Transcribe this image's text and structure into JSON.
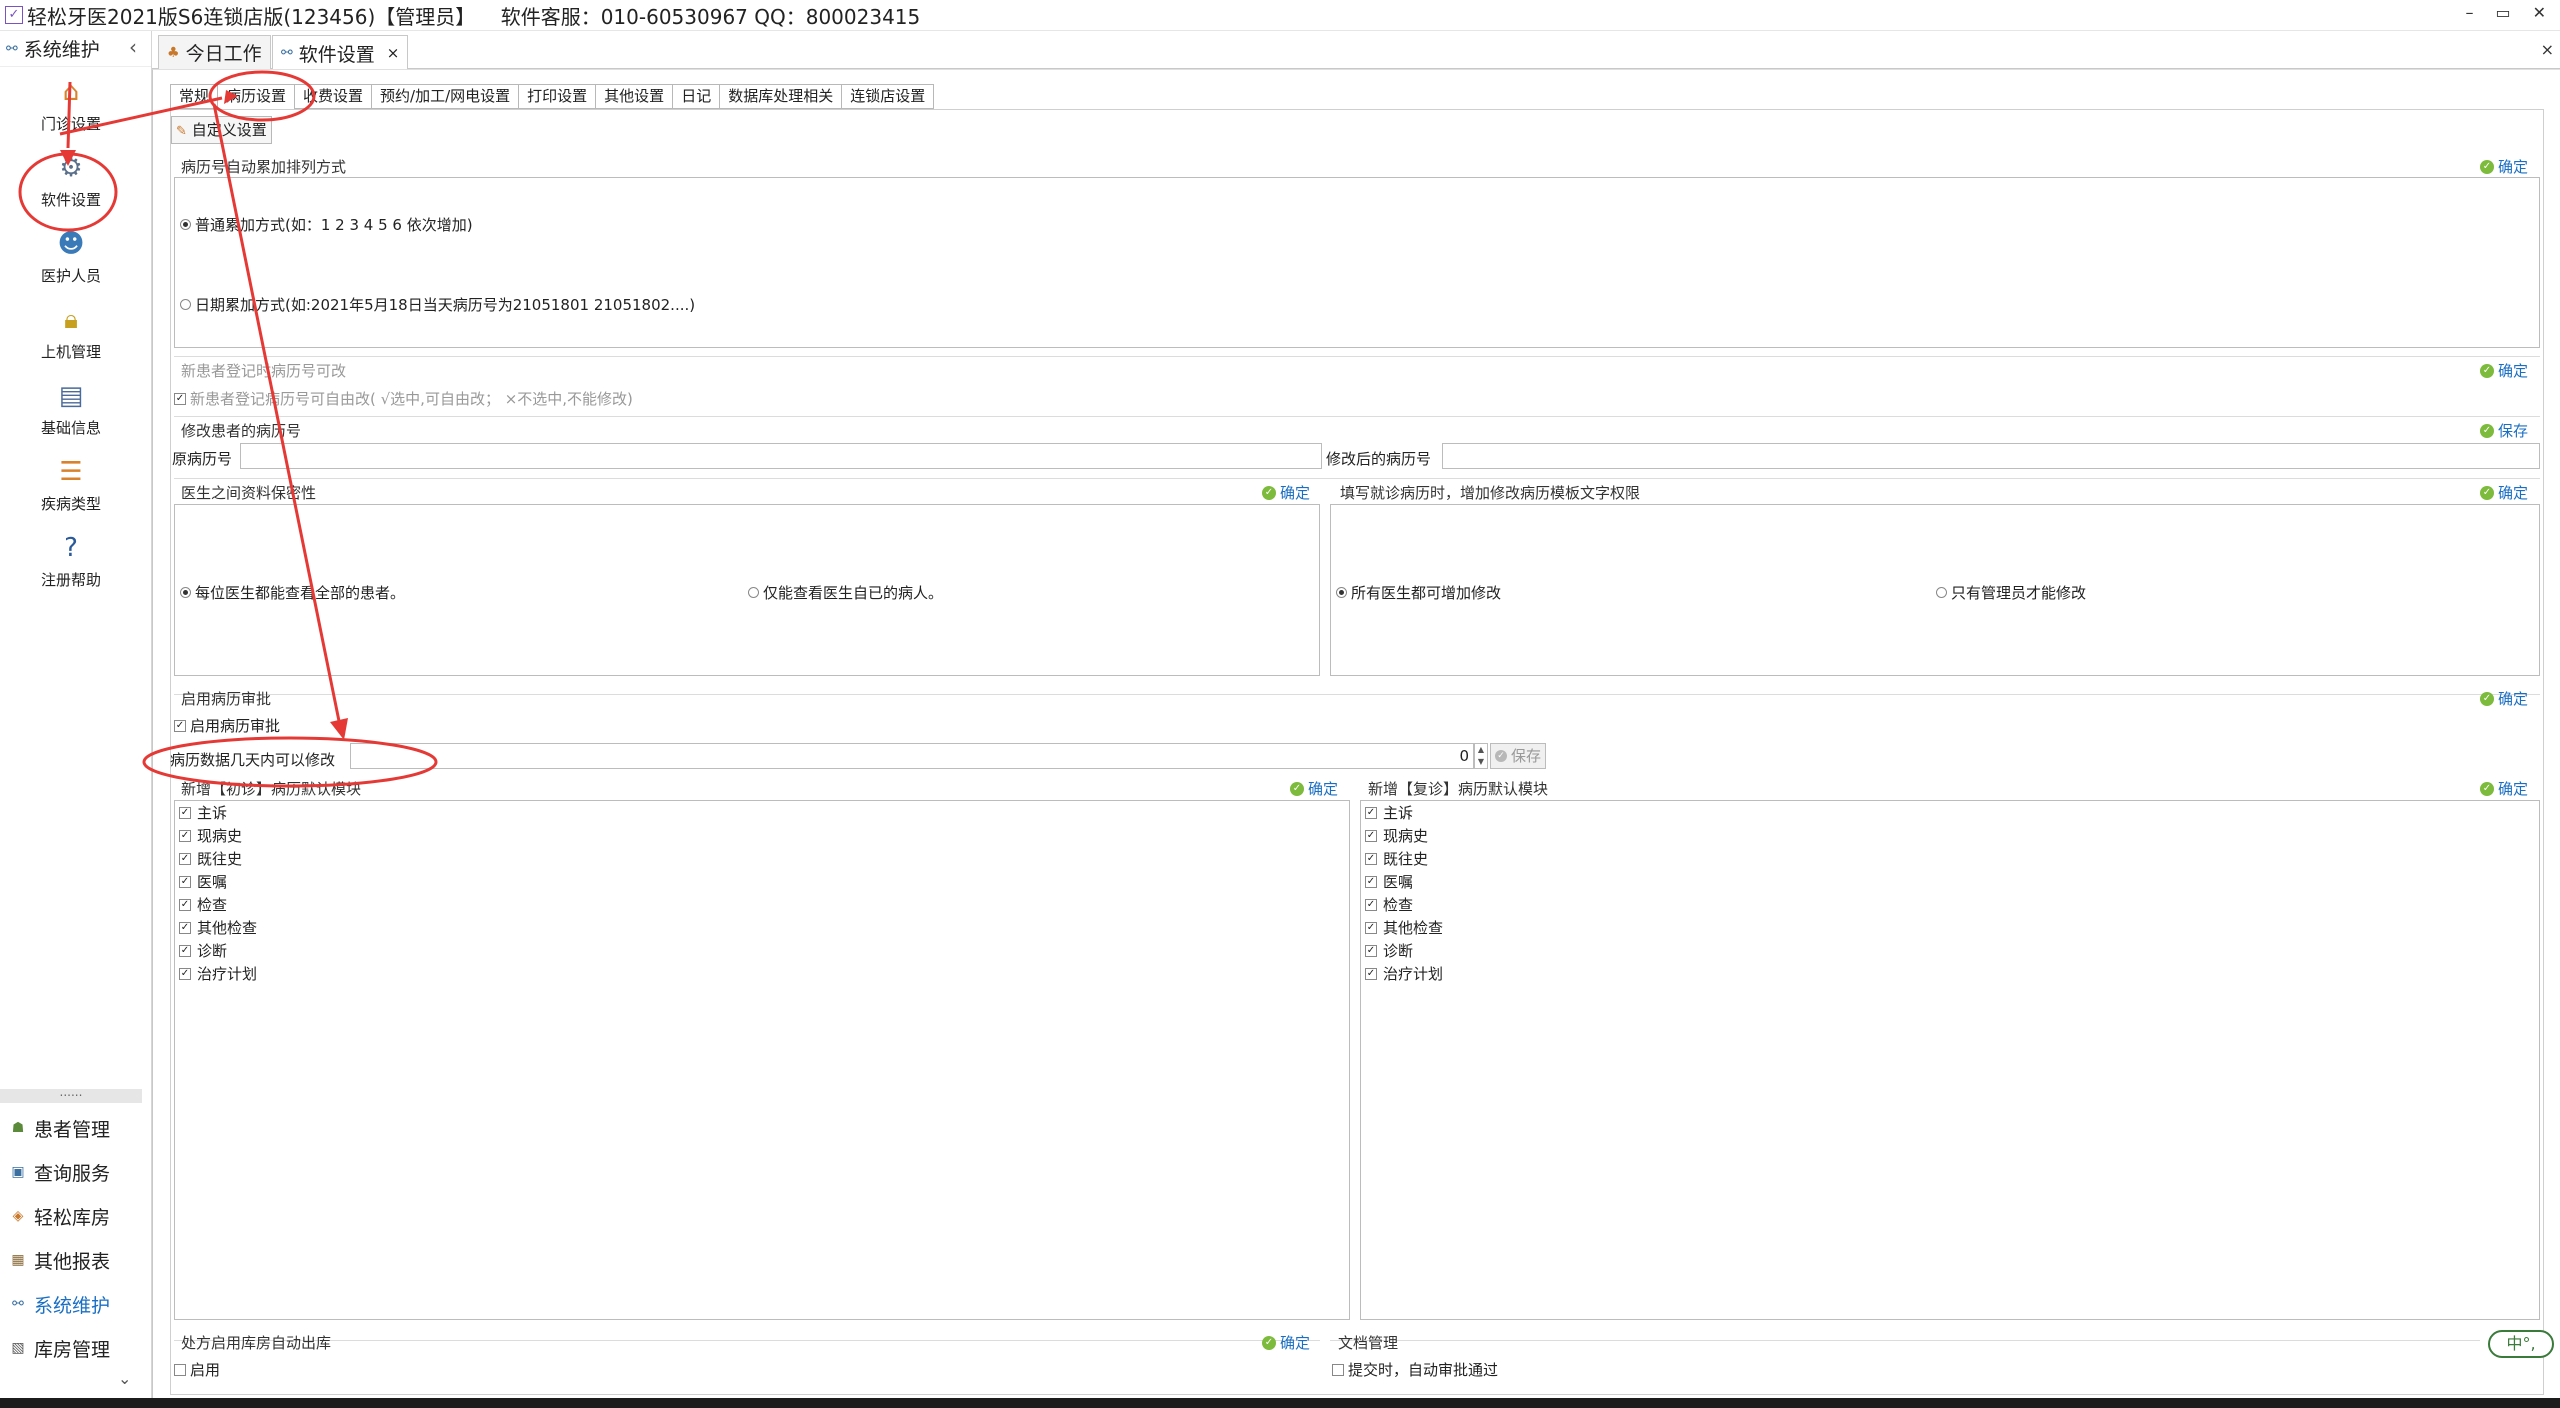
{
  "window": {
    "title": "轻松牙医2021版S6连锁店版(123456)【管理员】    软件客服：010-60530967 QQ：800023415",
    "min_glyph": "–",
    "restore_glyph": "▭",
    "close_glyph": "✕"
  },
  "sidebar": {
    "header": "系统维护",
    "collapse": "‹",
    "nav": [
      {
        "label": "门诊设置",
        "icon": "house-icon"
      },
      {
        "label": "软件设置",
        "icon": "gears-icon"
      },
      {
        "label": "医护人员",
        "icon": "people-icon"
      },
      {
        "label": "上机管理",
        "icon": "lock-icon"
      },
      {
        "label": "基础信息",
        "icon": "settings-doc-icon"
      },
      {
        "label": "疾病类型",
        "icon": "stack-icon"
      },
      {
        "label": "注册帮助",
        "icon": "help-icon"
      }
    ],
    "separator": "......",
    "modules": [
      {
        "label": "患者管理"
      },
      {
        "label": "查询服务"
      },
      {
        "label": "轻松库房"
      },
      {
        "label": "其他报表"
      },
      {
        "label": "系统维护"
      },
      {
        "label": "库房管理"
      }
    ],
    "bottom_chevron": "⌄"
  },
  "doc_tabs": [
    {
      "label": "今日工作"
    },
    {
      "label": "软件设置",
      "close": "×"
    }
  ],
  "close_all": "×",
  "sub_tabs": [
    "常规",
    "病历设置",
    "收费设置",
    "预约/加工/网电设置",
    "打印设置",
    "其他设置",
    "日记",
    "数据库处理相关",
    "连锁店设置"
  ],
  "custom_button": "自定义设置",
  "ok_label": "确定",
  "save_label": "保存",
  "numbering": {
    "title": "病历号自动累加排列方式",
    "option_normal": "普通累加方式(如：1  2  3  4  5  6 依次增加)",
    "option_date": "日期累加方式(如:2021年5月18日当天病历号为21051801 21051802....)",
    "selected": "normal"
  },
  "editable": {
    "title": "新患者登记时病历号可改",
    "checkbox": "新患者登记病历号可自由改( √选中,可自由改； ×不选中,不能修改)"
  },
  "modify_no": {
    "title": "修改患者的病历号",
    "original_label": "原病历号",
    "new_label": "修改后的病历号"
  },
  "privacy": {
    "title": "医生之间资料保密性",
    "option_all": "每位医生都能查看全部的患者。",
    "option_own": "仅能查看医生自已的病人。"
  },
  "template_rights": {
    "title": "填写就诊病历时，增加修改病历模板文字权限",
    "option_all": "所有医生都可增加修改",
    "option_admin": "只有管理员才能修改"
  },
  "approval": {
    "title": "启用病历审批",
    "checkbox": "启用病历审批"
  },
  "days_edit": {
    "label": "病历数据几天内可以修改",
    "value": "0"
  },
  "first_visit": {
    "title": "新增【初诊】病历默认模块",
    "items": [
      "主诉",
      "现病史",
      "既往史",
      "医嘱",
      "检查",
      "其他检查",
      "诊断",
      "治疗计划"
    ]
  },
  "return_visit": {
    "title": "新增【复诊】病历默认模块",
    "items": [
      "主诉",
      "现病史",
      "既往史",
      "医嘱",
      "检查",
      "其他检查",
      "诊断",
      "治疗计划"
    ]
  },
  "prescription": {
    "title": "处方启用库房自动出库",
    "checkbox": "启用"
  },
  "documents": {
    "title": "文档管理",
    "checkbox": "提交时，自动审批通过"
  },
  "ime": "中°,",
  "colors": {
    "accent": "#1a6fc4",
    "annotation": "#e53935",
    "ok_dot": "#7dbb3c"
  }
}
